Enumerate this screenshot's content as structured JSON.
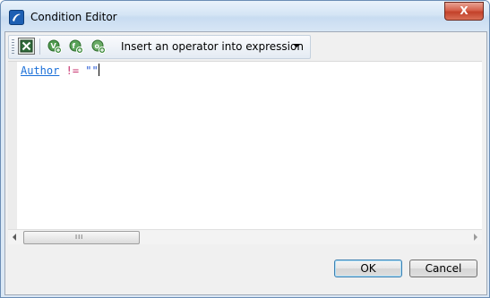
{
  "window": {
    "title": "Condition Editor",
    "close_glyph": "X"
  },
  "toolbar": {
    "buttons": [
      {
        "icon": "excel-grid-icon"
      },
      {
        "icon": "add-field-icon"
      },
      {
        "icon": "add-function-icon"
      },
      {
        "icon": "add-operator-icon"
      }
    ],
    "operator_label": "Insert an operator into expression"
  },
  "editor": {
    "tokens": {
      "field": "Author",
      "operator": "!=",
      "string": "\"\""
    }
  },
  "scrollbar": {
    "thumb_grip": "III"
  },
  "dialog": {
    "ok_label": "OK",
    "cancel_label": "Cancel"
  },
  "colors": {
    "field": "#1a6fd8",
    "operator": "#c8316e",
    "string": "#2155d4",
    "title_bg": "#d5e5f5"
  }
}
